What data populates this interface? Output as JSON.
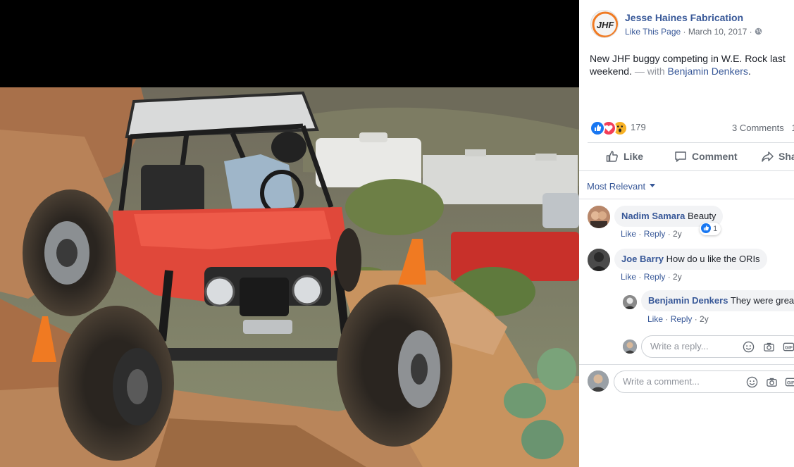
{
  "post": {
    "page_name": "Jesse Haines Fabrication",
    "logo_text": "JHF",
    "like_page": "Like This Page",
    "date": "March 10, 2017",
    "audience_icon": "globe-icon",
    "caption_text": "New JHF buggy competing in W.E. Rock last weekend.",
    "caption_with": "— with",
    "caption_tag": "Benjamin Denkers",
    "caption_end": "."
  },
  "reactions": {
    "types": [
      "like",
      "love",
      "wow"
    ],
    "count": "179",
    "comments": "3 Comments",
    "shares_partial": "1"
  },
  "actions": {
    "like": "Like",
    "comment": "Comment",
    "share": "Sha"
  },
  "sort_label": "Most Relevant",
  "comments": [
    {
      "name": "Nadim Samara",
      "text": "Beauty",
      "like": "Like",
      "reply": "Reply",
      "time": "2y",
      "reaction_count": "1"
    },
    {
      "name": "Joe Barry",
      "text": "How do u like the ORIs",
      "like": "Like",
      "reply": "Reply",
      "time": "2y"
    }
  ],
  "reply": {
    "name": "Benjamin Denkers",
    "text": "They were grea",
    "like": "Like",
    "reply": "Reply",
    "time": "2y"
  },
  "reply_input": {
    "placeholder": "Write a reply..."
  },
  "comment_input": {
    "placeholder": "Write a comment..."
  },
  "colors": {
    "link": "#385898",
    "reaction_like": "#1877f2",
    "reaction_love": "#f33e58",
    "reaction_wow": "#f7b125",
    "buggy": "#e0483a"
  }
}
